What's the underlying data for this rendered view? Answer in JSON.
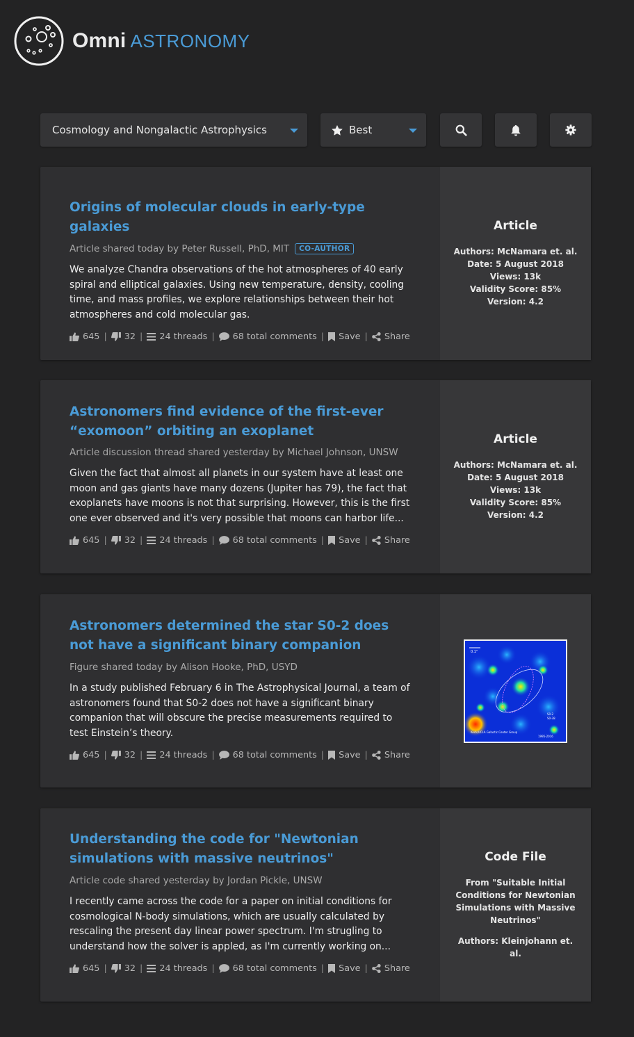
{
  "app": {
    "brand_primary": "Omni",
    "brand_secondary": "ASTRONOMY",
    "accent": "#4a9bd6"
  },
  "toolbar": {
    "category_value": "Cosmology and Nongalactic Astrophysics",
    "sort_value": "Best",
    "icons": [
      "search-icon",
      "bell-icon",
      "gear-icon"
    ]
  },
  "posts": [
    {
      "title": "Origins of molecular clouds in early-type galaxies",
      "byline": "Article shared today by Peter Russell, PhD, MIT",
      "badge": "CO-AUTHOR",
      "summary": "We analyze Chandra observations of the hot atmospheres of 40 early spiral and elliptical galaxies. Using new temperature, density, cooling time, and mass profiles, we explore relationships between their hot atmospheres and cold molecular gas.",
      "likes": "645",
      "dislikes": "32",
      "threads": "24 threads",
      "comments": "68 total comments",
      "save": "Save",
      "share": "Share",
      "side": {
        "type": "Article",
        "lines": [
          "Authors: McNamara et. al.",
          "Date: 5 August 2018",
          "Views: 13k",
          "Validity Score: 85%",
          "Version: 4.2"
        ]
      }
    },
    {
      "title": "Astronomers find evidence of the first-ever “exomoon” orbiting an exoplanet",
      "byline": "Article discussion thread shared yesterday by Michael Johnson, UNSW",
      "summary": "Given the fact that almost all planets in our system have at least one moon and gas giants have many dozens (Jupiter has 79), the fact that exoplanets have moons is not that surprising. However, this is the first one ever observed and it's very possible that moons can harbor life...",
      "likes": "645",
      "dislikes": "32",
      "threads": "24 threads",
      "comments": "68 total comments",
      "save": "Save",
      "share": "Share",
      "side": {
        "type": "Article",
        "lines": [
          "Authors: McNamara et. al.",
          "Date: 5 August 2018",
          "Views: 13k",
          "Validity Score: 85%",
          "Version: 4.2"
        ]
      }
    },
    {
      "title": "Astronomers determined the star S0-2 does not have a significant binary companion",
      "byline": "Figure shared today by Alison Hooke, PhD, USYD",
      "summary": "In a study published February 6 in The Astrophysical Journal, a team of astronomers found that S0-2 does not have a significant binary companion that will obscure the precise measurements required to test Einstein’s theory.",
      "likes": "645",
      "dislikes": "32",
      "threads": "24 threads",
      "comments": "68 total comments",
      "save": "Save",
      "share": "Share",
      "side": {
        "figure_caption_left": "Keck/UCLA Galactic Center Group",
        "figure_caption_right": "1995-2016",
        "figure_scale": "0.1\"",
        "figure_legend": [
          "S0-2",
          "S0-38"
        ]
      }
    },
    {
      "title": "Understanding the code for \"Newtonian simulations with massive neutrinos\"",
      "byline": "Article code shared yesterday by Jordan Pickle, UNSW",
      "summary": "I recently came across the code for a paper on initial conditions for cosmological N-body simulations, which are usually calculated by rescaling the present day linear power spectrum. I'm strugling to understand how the solver is appled, as I'm currently working on...",
      "likes": "645",
      "dislikes": "32",
      "threads": "24 threads",
      "comments": "68 total comments",
      "save": "Save",
      "share": "Share",
      "side": {
        "type": "Code File",
        "from": "From \"Suitable Initial Conditions for Newtonian Simulations with Massive Neutrinos\"",
        "authors": "Authors: Kleinjohann et. al."
      }
    }
  ]
}
